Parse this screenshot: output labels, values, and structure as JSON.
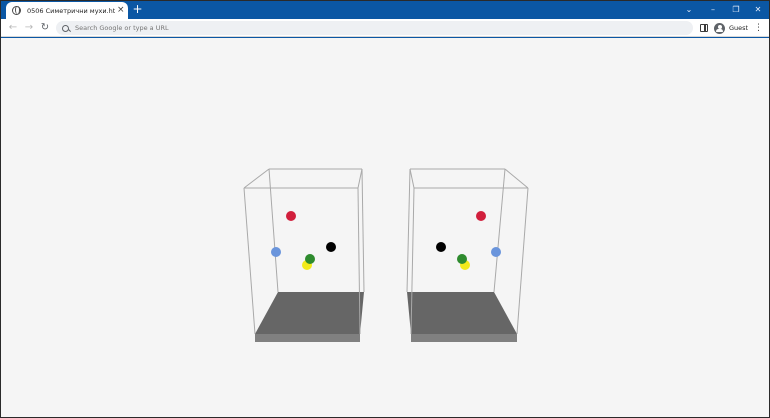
{
  "browser": {
    "tab": {
      "title": "0506 Симетрични мухи.html",
      "close": "×"
    },
    "new_tab": "+",
    "window_controls": {
      "chevron": "⌄",
      "minimize": "–",
      "restore": "❐",
      "close": "✕"
    },
    "nav": {
      "back": "←",
      "forward": "→",
      "reload": "↻"
    },
    "omnibox": {
      "placeholder": "Search Google or type a URL",
      "value": ""
    },
    "profile": {
      "name": "Guest"
    },
    "menu": "⋮"
  },
  "scene": {
    "boxes": [
      {
        "name": "left",
        "balls": [
          {
            "color": "#d11f3c",
            "name": "red"
          },
          {
            "color": "#6a95dc",
            "name": "blue"
          },
          {
            "color": "#000000",
            "name": "black"
          },
          {
            "color": "#f2ea1b",
            "name": "yellow"
          },
          {
            "color": "#2e8b2e",
            "name": "green"
          }
        ]
      },
      {
        "name": "right",
        "balls": [
          {
            "color": "#d11f3c",
            "name": "red"
          },
          {
            "color": "#6a95dc",
            "name": "blue"
          },
          {
            "color": "#000000",
            "name": "black"
          },
          {
            "color": "#f2ea1b",
            "name": "yellow"
          },
          {
            "color": "#2e8b2e",
            "name": "green"
          }
        ]
      }
    ],
    "colors": {
      "background": "#f5f5f5",
      "frame": "#a9a9a9",
      "floor_top": "#666666",
      "floor_side": "#808080"
    }
  }
}
